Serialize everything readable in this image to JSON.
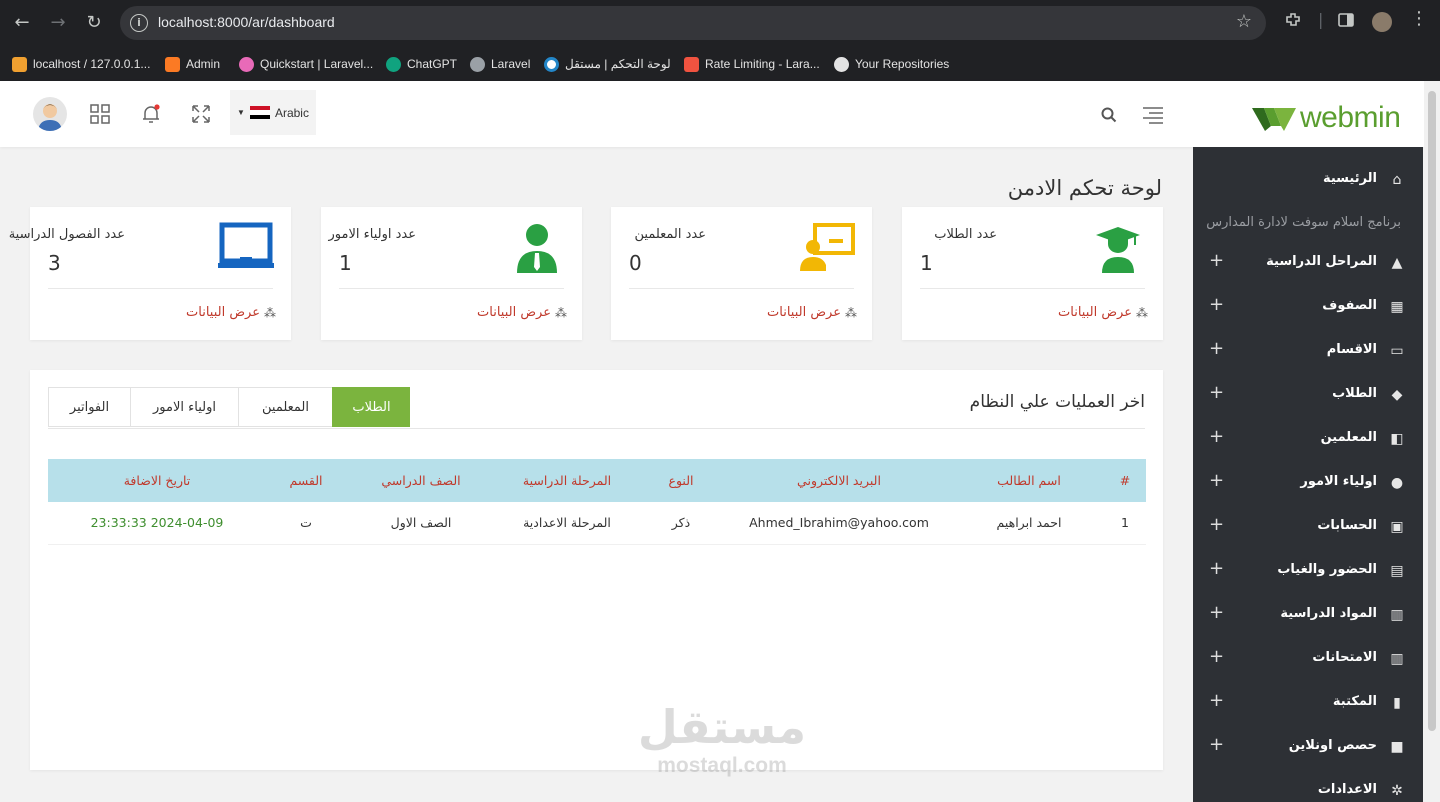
{
  "browser": {
    "url": "localhost:8000/ar/dashboard",
    "bookmarks": [
      {
        "label": "localhost / 127.0.0.1...",
        "icon": "phpmyadmin-icon",
        "color": "#f0a030"
      },
      {
        "label": "Admin",
        "icon": "xampp-icon",
        "color": "#fb7a24"
      },
      {
        "label": "Quickstart | Laravel...",
        "icon": "livewire-icon",
        "color": "#e86ab8"
      },
      {
        "label": "ChatGPT",
        "icon": "chatgpt-icon",
        "color": "#10a37f"
      },
      {
        "label": "Laravel",
        "icon": "globe-icon",
        "color": "#9aa0a6"
      },
      {
        "label": "لوحة التحكم | مستقل",
        "icon": "mostaql-icon",
        "color": "#2386c8"
      },
      {
        "label": "Rate Limiting - Lara...",
        "icon": "laravel-icon",
        "color": "#f05340"
      },
      {
        "label": "Your Repositories",
        "icon": "github-icon",
        "color": "#e3e3e3"
      }
    ]
  },
  "header": {
    "language": "Arabic",
    "logo_text": "webmin",
    "accent": "#5a9e2f"
  },
  "sidebar": {
    "caption": "برنامج اسلام سوفت لادارة المدارس",
    "items": [
      {
        "label": "الرئيسية",
        "icon": "home-icon",
        "expandable": false
      },
      {
        "label": "المراحل الدراسية",
        "icon": "school-icon",
        "expandable": true
      },
      {
        "label": "الصفوف",
        "icon": "building-icon",
        "expandable": true
      },
      {
        "label": "الاقسام",
        "icon": "laptop-icon",
        "expandable": true
      },
      {
        "label": "الطلاب",
        "icon": "graduate-icon",
        "expandable": true
      },
      {
        "label": "المعلمين",
        "icon": "teacher-icon",
        "expandable": true
      },
      {
        "label": "اولياء الامور",
        "icon": "user-icon",
        "expandable": true
      },
      {
        "label": "الحسابات",
        "icon": "money-icon",
        "expandable": true
      },
      {
        "label": "الحضور والغياب",
        "icon": "calendar-icon",
        "expandable": true
      },
      {
        "label": "المواد الدراسية",
        "icon": "book-open-icon",
        "expandable": true
      },
      {
        "label": "الامتحانات",
        "icon": "book-open-icon",
        "expandable": true
      },
      {
        "label": "المكتبة",
        "icon": "book-icon",
        "expandable": true
      },
      {
        "label": "حصص اونلاين",
        "icon": "video-icon",
        "expandable": true
      },
      {
        "label": "الاعدادات",
        "icon": "cogs-icon",
        "expandable": false
      }
    ]
  },
  "main": {
    "title": "لوحة تحكم الادمن",
    "cards": [
      {
        "title": "عدد الطلاب",
        "value": "1",
        "link": "عرض البيانات",
        "icon": "graduate-icon",
        "color": "#2aa043"
      },
      {
        "title": "عدد المعلمين",
        "value": "0",
        "link": "عرض البيانات",
        "icon": "teacher-board-icon",
        "color": "#f2b705"
      },
      {
        "title": "عدد اولياء الامور",
        "value": "1",
        "link": "عرض البيانات",
        "icon": "parent-icon",
        "color": "#2aa043"
      },
      {
        "title": "عدد الفصول الدراسية",
        "value": "3",
        "link": "عرض البيانات",
        "icon": "classroom-icon",
        "color": "#1565c0"
      }
    ],
    "operations": {
      "title": "اخر العمليات علي النظام",
      "tabs": [
        "الطلاب",
        "المعلمين",
        "اولياء الامور",
        "الفواتير"
      ],
      "active_tab": "الطلاب",
      "columns": [
        "#",
        "اسم الطالب",
        "البريد الالكتروني",
        "النوع",
        "المرحلة الدراسية",
        "الصف الدراسي",
        "القسم",
        "تاريخ الاضافة"
      ],
      "rows": [
        [
          "1",
          "احمد ابراهيم",
          "Ahmed_Ibrahim@yahoo.com",
          "ذكر",
          "المرحلة الاعدادية",
          "الصف الاول",
          "ت",
          "2024-04-09 23:33:33"
        ]
      ]
    }
  },
  "watermark": {
    "arabic": "مستقل",
    "latin": "mostaql.com"
  }
}
